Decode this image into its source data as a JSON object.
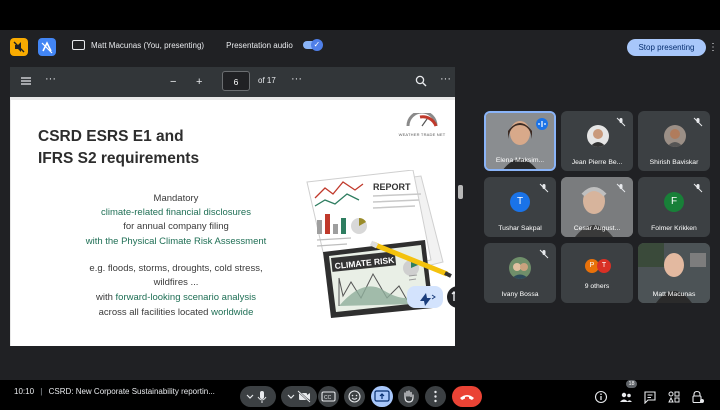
{
  "presenting_bar": {
    "text": "Matt Macunas (You, presenting)",
    "audio_label": "Presentation audio",
    "stop_label": "Stop presenting"
  },
  "pdf_viewer": {
    "current_page": "6",
    "total_pages": "of 17"
  },
  "slide": {
    "title_line1": "CSRD ESRS E1 and",
    "title_line2": "IFRS S2 requirements",
    "line1": "Mandatory",
    "line2": "climate-related financial disclosures",
    "line3": "for annual company filing",
    "line4": "with the Physical Climate Risk Assessment",
    "line5": "e.g. floods, storms, droughts, cold stress,",
    "line6": "wildfires ...",
    "line7_prefix": "with",
    "line7_green": "forward-looking scenario analysis",
    "line8_prefix": "across all facilities located",
    "line8_green": "worldwide",
    "logo_text": "WEATHER TRADE NET",
    "report_label": "REPORT",
    "climate_risk_label": "CLIMATE RISK"
  },
  "participants": [
    {
      "name": "Elena Maksim...",
      "speaking": true
    },
    {
      "name": "Jean Pierre Be..."
    },
    {
      "name": "Shirish Baviskar"
    },
    {
      "name": "Tushar Sakpal",
      "initial": "T",
      "color": "#1a73e8"
    },
    {
      "name": "Cesar August..."
    },
    {
      "name": "Folmer Krikken",
      "initial": "F",
      "color": "#188038"
    },
    {
      "name": "Ivany Bossa"
    },
    {
      "name": "9 others",
      "initials": [
        "P",
        "T"
      ]
    },
    {
      "name": "Matt Macunas"
    }
  ],
  "bottom_bar": {
    "time": "10:10",
    "meeting_title": "CSRD: New Corporate Sustainability reportin...",
    "people_count": "18"
  },
  "colors": {
    "background": "#202124",
    "accent": "#8ab4f8",
    "stop_button": "#a8c7fa",
    "end_call": "#ea4335",
    "slide_green": "#1f6f55"
  }
}
